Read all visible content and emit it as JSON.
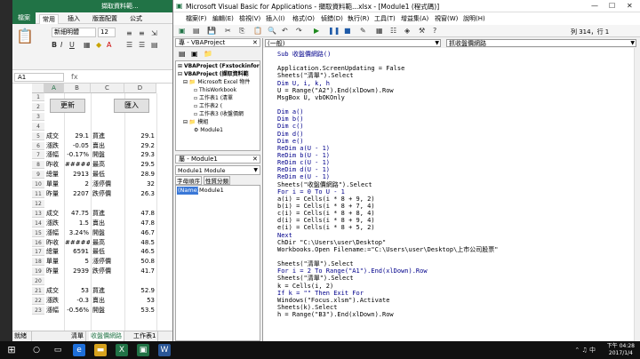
{
  "excel": {
    "title": "擷取資料範...",
    "tabs": [
      "檔案",
      "常用",
      "插入",
      "版面配置",
      "公式"
    ],
    "font_name": "新細明體",
    "font_size": "12",
    "name_box": "A1",
    "columns": [
      "A",
      "B",
      "C",
      "D"
    ],
    "buttons": {
      "refresh": "更新",
      "import": "匯入"
    },
    "rows": [
      {
        "n": "1",
        "a": "",
        "b": "",
        "c": "",
        "d": ""
      },
      {
        "n": "2",
        "a": "",
        "b": "",
        "c": "",
        "d": ""
      },
      {
        "n": "3",
        "a": "",
        "b": "",
        "c": "",
        "d": ""
      },
      {
        "n": "4",
        "a": "",
        "b": "",
        "c": "",
        "d": ""
      },
      {
        "n": "5",
        "a": "成交",
        "b": "29.1",
        "c": "買進",
        "d": "29.1"
      },
      {
        "n": "6",
        "a": "漲跌",
        "b": "-0.05",
        "c": "賣出",
        "d": "29.2"
      },
      {
        "n": "7",
        "a": "漲幅",
        "b": "-0.17%",
        "c": "開盤",
        "d": "29.3"
      },
      {
        "n": "8",
        "a": "昨收",
        "b": "######",
        "c": "最高",
        "d": "29.5"
      },
      {
        "n": "9",
        "a": "總量",
        "b": "2913",
        "c": "最低",
        "d": "28.9"
      },
      {
        "n": "10",
        "a": "單量",
        "b": "2",
        "c": "漲停價",
        "d": "32"
      },
      {
        "n": "11",
        "a": "昨量",
        "b": "2207",
        "c": "跌停價",
        "d": "26.3"
      },
      {
        "n": "12",
        "a": "",
        "b": "",
        "c": "",
        "d": ""
      },
      {
        "n": "13",
        "a": "成交",
        "b": "47.75",
        "c": "買進",
        "d": "47.8"
      },
      {
        "n": "14",
        "a": "漲跌",
        "b": "1.5",
        "c": "賣出",
        "d": "47.8"
      },
      {
        "n": "15",
        "a": "漲幅",
        "b": "3.24%",
        "c": "開盤",
        "d": "46.7"
      },
      {
        "n": "16",
        "a": "昨收",
        "b": "######",
        "c": "最高",
        "d": "48.5"
      },
      {
        "n": "17",
        "a": "總量",
        "b": "6591",
        "c": "最低",
        "d": "46.5"
      },
      {
        "n": "18",
        "a": "單量",
        "b": "5",
        "c": "漲停價",
        "d": "50.8"
      },
      {
        "n": "19",
        "a": "昨量",
        "b": "2939",
        "c": "跌停價",
        "d": "41.7"
      },
      {
        "n": "20",
        "a": "",
        "b": "",
        "c": "",
        "d": ""
      },
      {
        "n": "21",
        "a": "成交",
        "b": "53",
        "c": "買進",
        "d": "52.9"
      },
      {
        "n": "22",
        "a": "漲跌",
        "b": "-0.3",
        "c": "賣出",
        "d": "53"
      },
      {
        "n": "23",
        "a": "漲幅",
        "b": "-0.56%",
        "c": "開盤",
        "d": "53.5"
      }
    ],
    "sheet_tabs": [
      "清單",
      "收盤價網路",
      "工作表1"
    ],
    "status": "就緒"
  },
  "vbe": {
    "title": "Microsoft Visual Basic for Applications - 擷取資料範...xlsx - [Module1 (程式碼)]",
    "menu": [
      "檔案(F)",
      "編輯(E)",
      "檢視(V)",
      "插入(I)",
      "格式(O)",
      "偵錯(D)",
      "執行(R)",
      "工具(T)",
      "增益集(A)",
      "視窗(W)",
      "說明(H)"
    ],
    "position": "列 314，行 1",
    "project_title": "專 - VBAProject",
    "tree": [
      "VBAProject (Fxstockinfor",
      "VBAProject (擷取資料範",
      "Microsoft Excel 物件",
      "ThisWorkbook",
      "工作表1 (清單",
      "工作表2 (",
      "工作表3 (收盤價網",
      "模組",
      "Module1"
    ],
    "properties_title": "屬 - Module1",
    "properties_combo": "Module1  Module",
    "properties_tabs": [
      "字母順序",
      "性質分類"
    ],
    "prop_name": "(Name)",
    "prop_value": "Module1",
    "code_combo_left": "(一般)",
    "code_combo_right": "抓收盤價網路",
    "code": [
      "Sub 收盤價網路()",
      "",
      "Application.ScreenUpdating = False",
      "Sheets(\"清單\").Select",
      "Dim U, i, k, h",
      "U = Range(\"A2\").End(xlDown).Row",
      "MsgBox U, vbOKOnly",
      "",
      "Dim a()",
      "Dim b()",
      "Dim c()",
      "Dim d()",
      "Dim e()",
      "ReDim a(U - 1)",
      "ReDim b(U - 1)",
      "ReDim c(U - 1)",
      "ReDim d(U - 1)",
      "ReDim e(U - 1)",
      "Sheets(\"收盤價網路\").Select",
      "For i = 0 To U - 1",
      "a(i) = Cells(i * 8 + 9, 2)",
      "b(i) = Cells(i * 8 + 7, 4)",
      "c(i) = Cells(i * 8 + 8, 4)",
      "d(i) = Cells(i * 8 + 9, 4)",
      "e(i) = Cells(i * 8 + 5, 2)",
      "Next",
      "ChDir \"C:\\Users\\user\\Desktop\"",
      "Workbooks.Open Filename:=\"C:\\Users\\user\\Desktop\\上市公司股票\"",
      "",
      "Sheets(\"清單\").Select",
      "For i = 2 To Range(\"A1\").End(xlDown).Row",
      "Sheets(\"清單\").Select",
      "k = Cells(i, 2)",
      "If k = \"\" Then Exit For",
      "Windows(\"Focus.xlsm\").Activate",
      "Sheets(k).Select",
      "h = Range(\"B3\").End(xlDown).Row"
    ]
  },
  "taskbar": {
    "time": "下午 04:28",
    "date": "2017/1/4",
    "lang": "中"
  },
  "colors": {
    "excel_green": "#217346",
    "code_blue": "#00008b"
  }
}
